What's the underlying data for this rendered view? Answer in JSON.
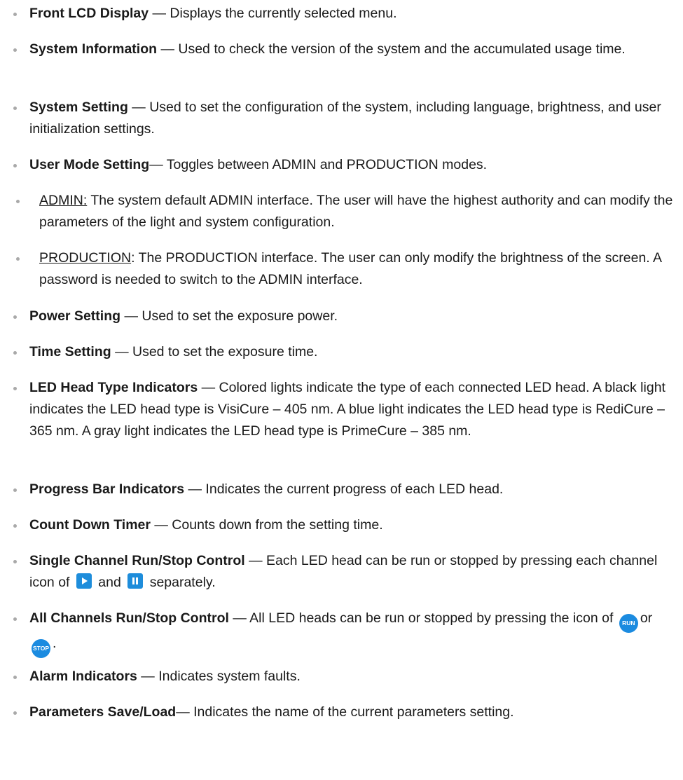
{
  "colors": {
    "icon_blue": "#1e8ddb",
    "icon_round_blue": "#1b8be0",
    "bullet": "#a9a9a9"
  },
  "items": [
    {
      "term": "Front LCD Display",
      "desc": " — Displays the currently selected menu."
    },
    {
      "term": "System Information",
      "desc": " — Used to check the version of the system and the accumulated usage time."
    },
    {
      "term": "System Setting",
      "desc": " — Used to set the configuration of the system, including language, brightness, and user initialization settings."
    },
    {
      "term": "User Mode Setting",
      "desc": "— Toggles between ADMIN and PRODUCTION modes."
    },
    {
      "label": "ADMIN:",
      "desc": " The system default ADMIN interface. The user will have the highest authority and can modify the parameters of the light and system configuration."
    },
    {
      "label": "PRODUCTION",
      "desc": ": The PRODUCTION interface. The user can only modify the brightness of the screen. A password is needed to switch to the ADMIN interface."
    },
    {
      "term": "Power Setting",
      "desc": " — Used to set the exposure power."
    },
    {
      "term": "Time Setting",
      "desc": " — Used to set the exposure time."
    },
    {
      "term": "LED Head Type Indicators",
      "desc": " — Colored lights indicate the type of each connected LED head. A black light indicates the LED head type is VisiCure – 405 nm. A blue light indicates the LED head type is RediCure – 365 nm. A gray light indicates the LED head type is PrimeCure – 385 nm."
    },
    {
      "term": "Progress Bar Indicators",
      "desc": " — Indicates the current progress of each LED head."
    },
    {
      "term": "Count Down Timer",
      "desc": " — Counts down from the setting time."
    },
    {
      "term": "Single Channel Run/Stop Control",
      "desc_a": " — Each LED head can be run or stopped by pressing each channel icon of",
      "desc_b": "and",
      "desc_c": "separately."
    },
    {
      "term": "All Channels Run/Stop Control",
      "desc_a": " — All LED heads can be run or stopped by pressing the icon of",
      "run_label": "RUN",
      "desc_b": "or",
      "stop_label": "STOP",
      "desc_c": "."
    },
    {
      "term": "Alarm Indicators",
      "desc": " — Indicates system faults."
    },
    {
      "term": "Parameters Save/Load",
      "desc": "— Indicates the name of the current parameters setting."
    }
  ]
}
